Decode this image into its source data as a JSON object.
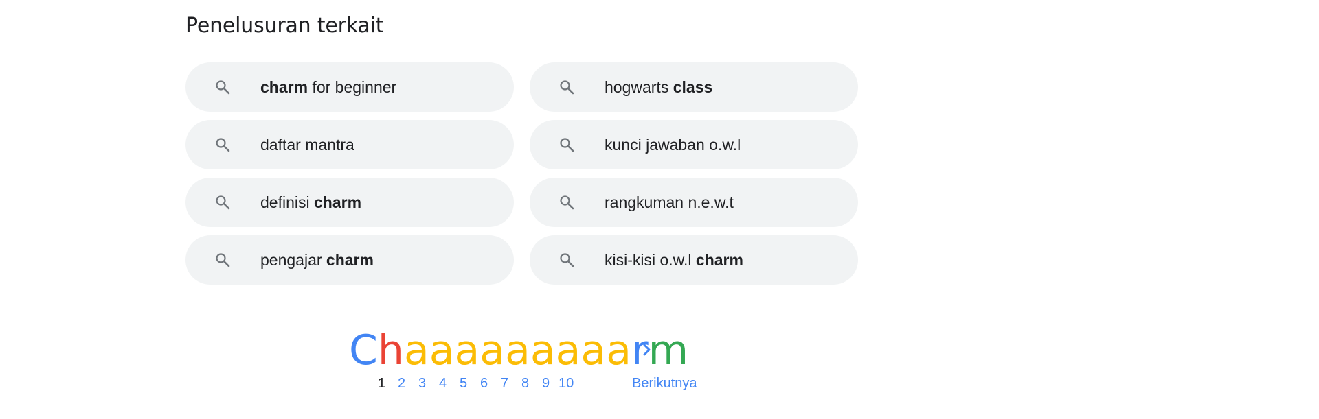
{
  "related": {
    "title": "Penelusuran terkait",
    "items": [
      {
        "parts": [
          {
            "text": "charm",
            "bold": true
          },
          {
            "text": " for beginner",
            "bold": false
          }
        ]
      },
      {
        "parts": [
          {
            "text": "hogwarts ",
            "bold": false
          },
          {
            "text": "class",
            "bold": true
          }
        ]
      },
      {
        "parts": [
          {
            "text": "daftar mantra",
            "bold": false
          }
        ]
      },
      {
        "parts": [
          {
            "text": "kunci jawaban o.w.l",
            "bold": false
          }
        ]
      },
      {
        "parts": [
          {
            "text": "definisi ",
            "bold": false
          },
          {
            "text": "charm",
            "bold": true
          }
        ]
      },
      {
        "parts": [
          {
            "text": "rangkuman n.e.w.t",
            "bold": false
          }
        ]
      },
      {
        "parts": [
          {
            "text": "pengajar ",
            "bold": false
          },
          {
            "text": "charm",
            "bold": true
          }
        ]
      },
      {
        "parts": [
          {
            "text": "kisi-kisi o.w.l ",
            "bold": false
          },
          {
            "text": "charm",
            "bold": true
          }
        ]
      }
    ],
    "icon": "search-icon"
  },
  "pagination": {
    "logo_letters": [
      {
        "ch": "C",
        "color": "#4285f4"
      },
      {
        "ch": "h",
        "color": "#ea4335"
      },
      {
        "ch": "a",
        "color": "#fbbc05"
      },
      {
        "ch": "a",
        "color": "#fbbc05"
      },
      {
        "ch": "a",
        "color": "#fbbc05"
      },
      {
        "ch": "a",
        "color": "#fbbc05"
      },
      {
        "ch": "a",
        "color": "#fbbc05"
      },
      {
        "ch": "a",
        "color": "#fbbc05"
      },
      {
        "ch": "a",
        "color": "#fbbc05"
      },
      {
        "ch": "a",
        "color": "#fbbc05"
      },
      {
        "ch": "a",
        "color": "#fbbc05"
      },
      {
        "ch": "r",
        "color": "#4285f4"
      },
      {
        "ch": "m",
        "color": "#34a853"
      }
    ],
    "pages": [
      "1",
      "2",
      "3",
      "4",
      "5",
      "6",
      "7",
      "8",
      "9",
      "10"
    ],
    "current_page": "1",
    "next_label": "Berikutnya",
    "next_icon": "chevron-right-icon"
  },
  "colors": {
    "chip_bg": "#f1f3f4",
    "link_blue": "#4285f4",
    "text": "#202124",
    "icon": "#70757a"
  }
}
